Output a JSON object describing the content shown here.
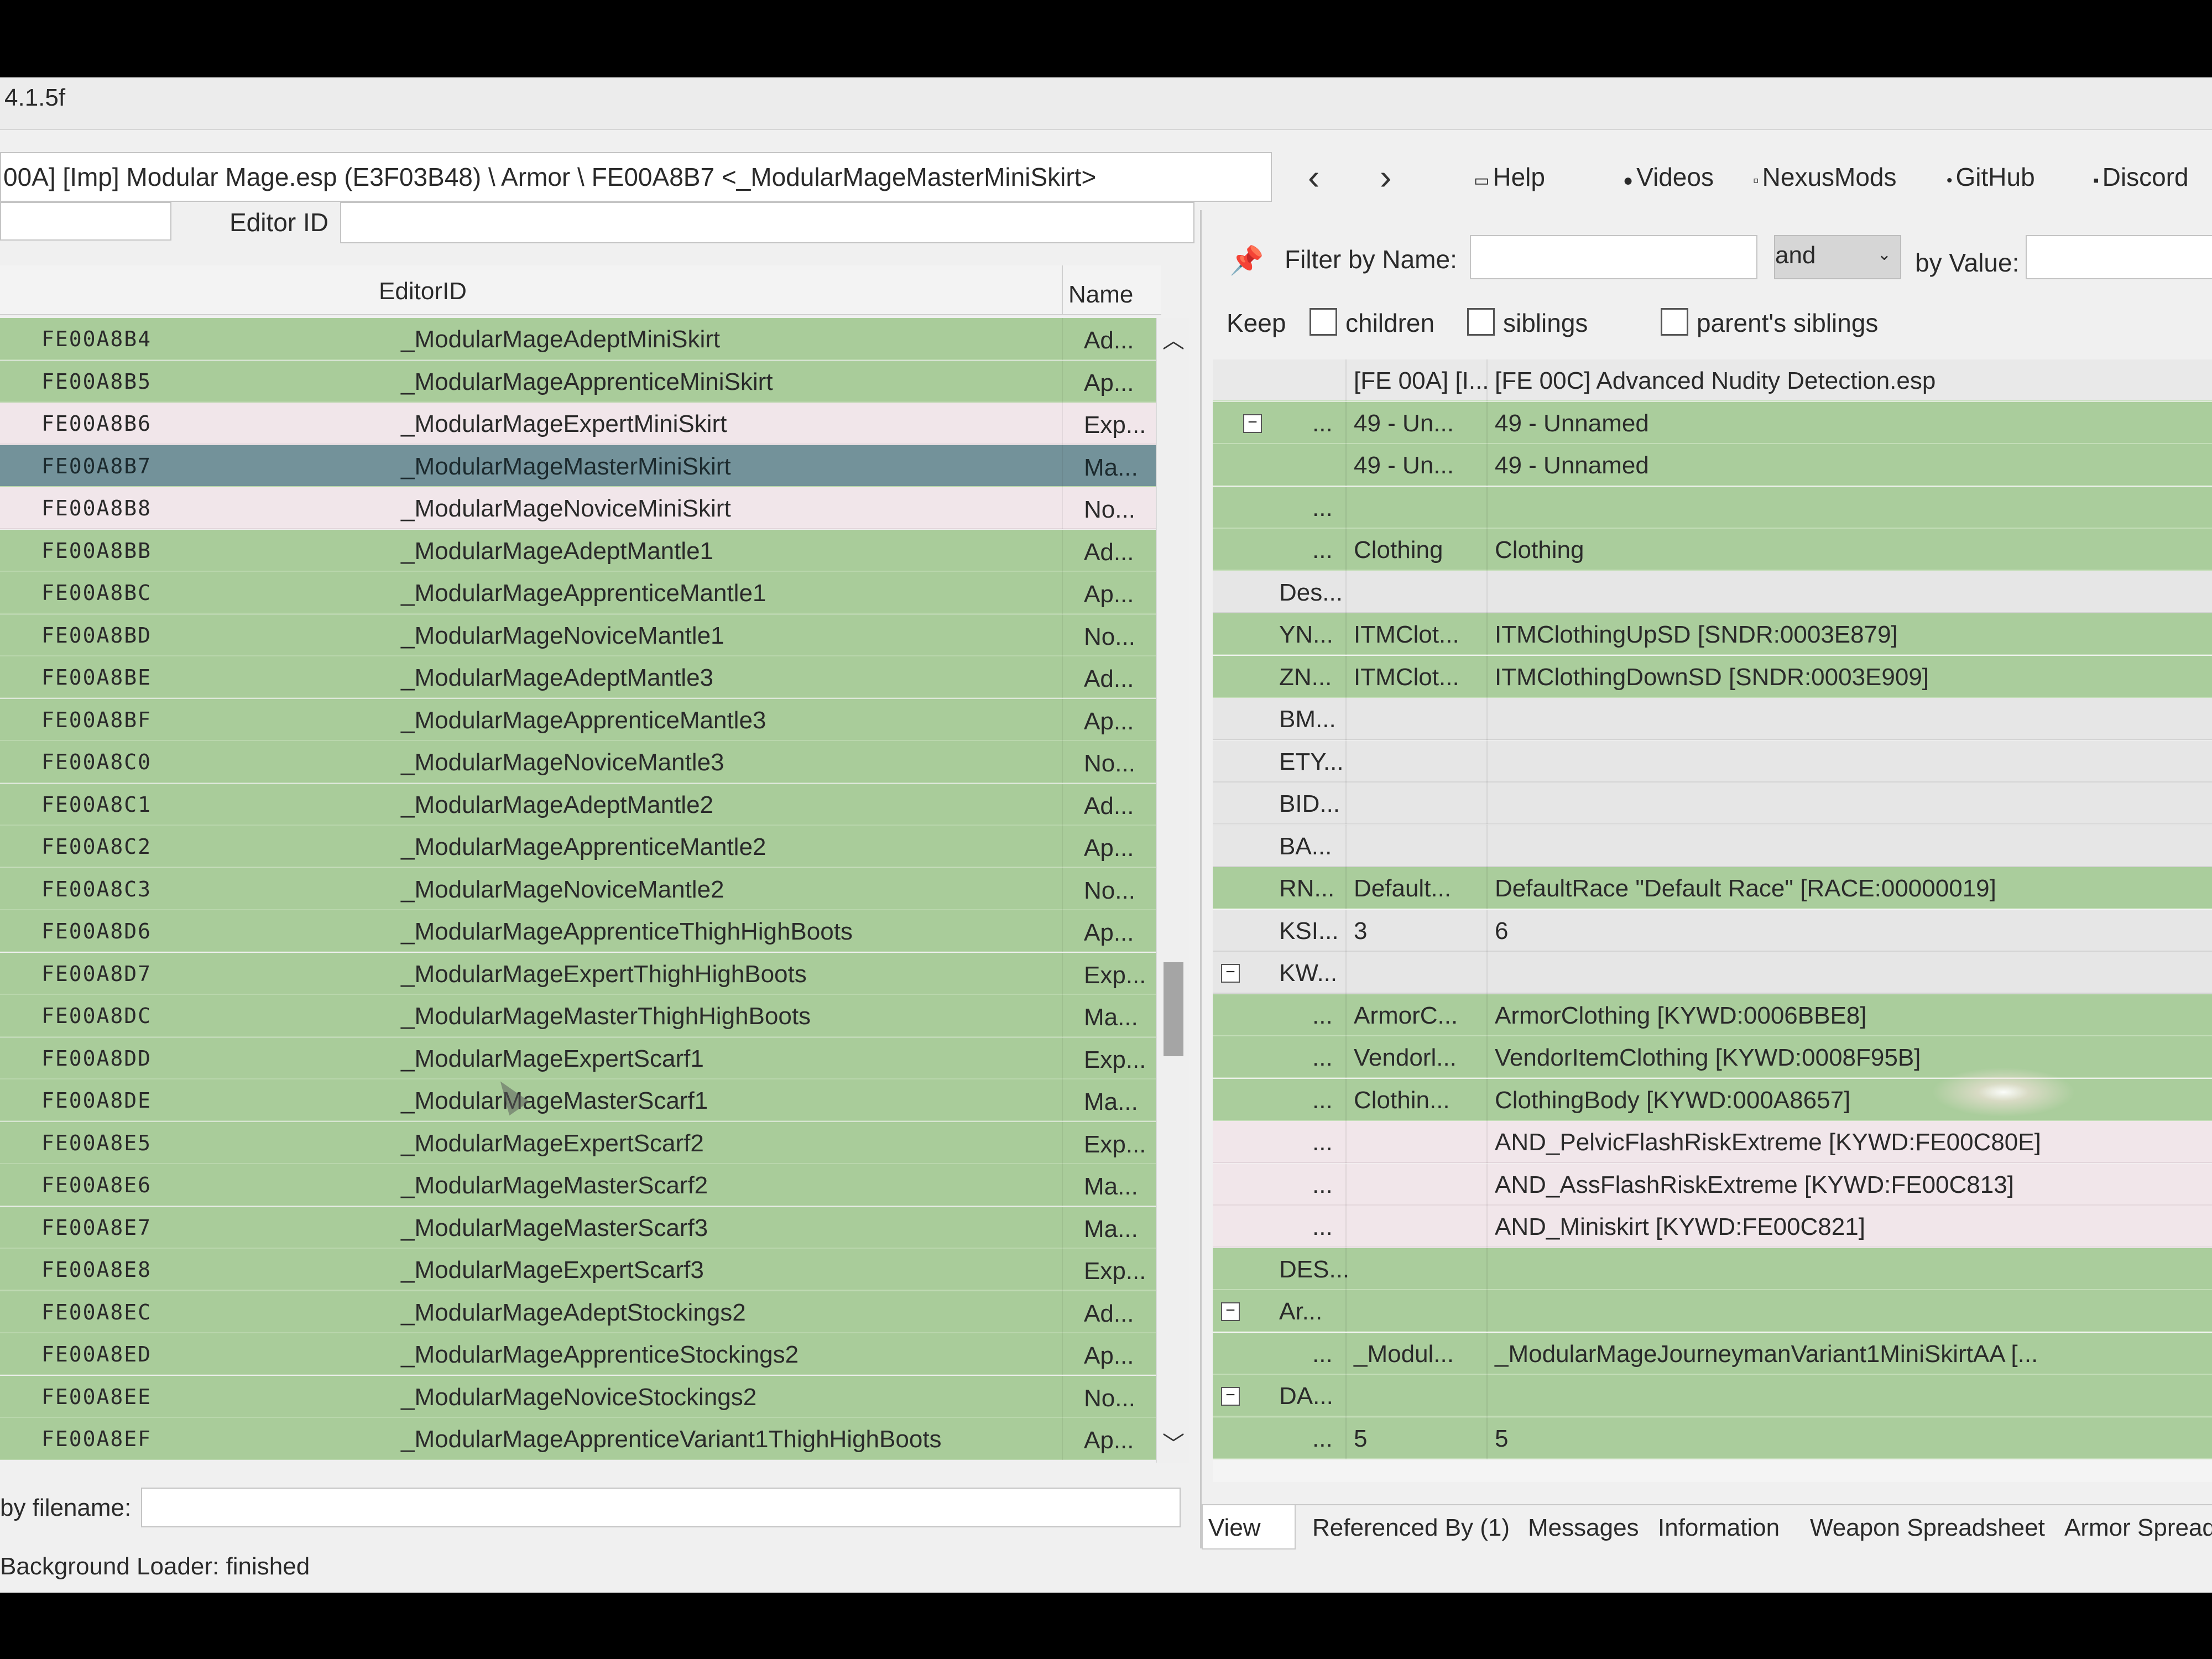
{
  "window": {
    "title": "4.1.5f"
  },
  "toolbar": {
    "path": "00A] [Imp] Modular Mage.esp (E3F03B48) \\ Armor \\ FE00A8B7 <_ModularMageMasterMiniSkirt>",
    "back_icon": "chevron-left-icon",
    "forward_icon": "chevron-right-icon",
    "links": {
      "help": "Help",
      "videos": "Videos",
      "nexusmods": "NexusMods",
      "github": "GitHub",
      "discord": "Discord"
    }
  },
  "left": {
    "editor_id_label": "Editor ID",
    "columns": {
      "editorid": "EditorID",
      "name": "Name"
    },
    "rows": [
      {
        "fid": "FE00A8B4",
        "edid": "_ModularMageAdeptMiniSkirt",
        "name": "Ad..."
      },
      {
        "fid": "FE00A8B5",
        "edid": "_ModularMageApprenticeMiniSkirt",
        "name": "Ap..."
      },
      {
        "fid": "FE00A8B6",
        "edid": "_ModularMageExpertMiniSkirt",
        "name": "Exp..."
      },
      {
        "fid": "FE00A8B7",
        "edid": "_ModularMageMasterMiniSkirt",
        "name": "Ma..."
      },
      {
        "fid": "FE00A8B8",
        "edid": "_ModularMageNoviceMiniSkirt",
        "name": "No..."
      },
      {
        "fid": "FE00A8BB",
        "edid": "_ModularMageAdeptMantle1",
        "name": "Ad..."
      },
      {
        "fid": "FE00A8BC",
        "edid": "_ModularMageApprenticeMantle1",
        "name": "Ap..."
      },
      {
        "fid": "FE00A8BD",
        "edid": "_ModularMageNoviceMantle1",
        "name": "No..."
      },
      {
        "fid": "FE00A8BE",
        "edid": "_ModularMageAdeptMantle3",
        "name": "Ad..."
      },
      {
        "fid": "FE00A8BF",
        "edid": "_ModularMageApprenticeMantle3",
        "name": "Ap..."
      },
      {
        "fid": "FE00A8C0",
        "edid": "_ModularMageNoviceMantle3",
        "name": "No..."
      },
      {
        "fid": "FE00A8C1",
        "edid": "_ModularMageAdeptMantle2",
        "name": "Ad..."
      },
      {
        "fid": "FE00A8C2",
        "edid": "_ModularMageApprenticeMantle2",
        "name": "Ap..."
      },
      {
        "fid": "FE00A8C3",
        "edid": "_ModularMageNoviceMantle2",
        "name": "No..."
      },
      {
        "fid": "FE00A8D6",
        "edid": "_ModularMageApprenticeThighHighBoots",
        "name": "Ap..."
      },
      {
        "fid": "FE00A8D7",
        "edid": "_ModularMageExpertThighHighBoots",
        "name": "Exp..."
      },
      {
        "fid": "FE00A8DC",
        "edid": "_ModularMageMasterThighHighBoots",
        "name": "Ma..."
      },
      {
        "fid": "FE00A8DD",
        "edid": "_ModularMageExpertScarf1",
        "name": "Exp..."
      },
      {
        "fid": "FE00A8DE",
        "edid": "_ModularMageMasterScarf1",
        "name": "Ma..."
      },
      {
        "fid": "FE00A8E5",
        "edid": "_ModularMageExpertScarf2",
        "name": "Exp..."
      },
      {
        "fid": "FE00A8E6",
        "edid": "_ModularMageMasterScarf2",
        "name": "Ma..."
      },
      {
        "fid": "FE00A8E7",
        "edid": "_ModularMageMasterScarf3",
        "name": "Ma..."
      },
      {
        "fid": "FE00A8E8",
        "edid": "_ModularMageExpertScarf3",
        "name": "Exp..."
      },
      {
        "fid": "FE00A8EC",
        "edid": "_ModularMageAdeptStockings2",
        "name": "Ad..."
      },
      {
        "fid": "FE00A8ED",
        "edid": "_ModularMageApprenticeStockings2",
        "name": "Ap..."
      },
      {
        "fid": "FE00A8EE",
        "edid": "_ModularMageNoviceStockings2",
        "name": "No..."
      },
      {
        "fid": "FE00A8EF",
        "edid": "_ModularMageApprenticeVariant1ThighHighBoots",
        "name": "Ap..."
      }
    ],
    "filename_label": "by filename:"
  },
  "right": {
    "filter_name_label": "Filter by Name:",
    "filter_op": "and",
    "filter_value_label": "by Value:",
    "keep_label": "Keep",
    "keep_children": "children",
    "keep_siblings": "siblings",
    "keep_parents_siblings": "parent's siblings",
    "tree": [
      {
        "label": "",
        "c2": "[FE 00A] [I...",
        "c3": "[FE 00C] Advanced Nudity Detection.esp"
      },
      {
        "label": "...",
        "c2": "49 - Un...",
        "c3": "49 - Unnamed"
      },
      {
        "label": "",
        "c2": "49 - Un...",
        "c3": "49 - Unnamed"
      },
      {
        "label": "...",
        "c2": "",
        "c3": ""
      },
      {
        "label": "...",
        "c2": "Clothing",
        "c3": "Clothing"
      },
      {
        "label": "Des...",
        "c2": "",
        "c3": ""
      },
      {
        "label": "YN...",
        "c2": "ITMClot...",
        "c3": "ITMClothingUpSD [SNDR:0003E879]"
      },
      {
        "label": "ZN...",
        "c2": "ITMClot...",
        "c3": "ITMClothingDownSD [SNDR:0003E909]"
      },
      {
        "label": "BM...",
        "c2": "",
        "c3": ""
      },
      {
        "label": "ETY...",
        "c2": "",
        "c3": ""
      },
      {
        "label": "BID...",
        "c2": "",
        "c3": ""
      },
      {
        "label": "BA...",
        "c2": "",
        "c3": ""
      },
      {
        "label": "RN...",
        "c2": "Default...",
        "c3": "DefaultRace \"Default Race\" [RACE:00000019]"
      },
      {
        "label": "KSI...",
        "c2": "3",
        "c3": "6"
      },
      {
        "label": "KW...",
        "c2": "",
        "c3": ""
      },
      {
        "label": "...",
        "c2": "ArmorC...",
        "c3": "ArmorClothing [KYWD:0006BBE8]"
      },
      {
        "label": "...",
        "c2": "Vendorl...",
        "c3": "VendorItemClothing [KYWD:0008F95B]"
      },
      {
        "label": "...",
        "c2": "Clothin...",
        "c3": "ClothingBody [KYWD:000A8657]"
      },
      {
        "label": "...",
        "c2": "",
        "c3": "AND_PelvicFlashRiskExtreme [KYWD:FE00C80E]"
      },
      {
        "label": "...",
        "c2": "",
        "c3": "AND_AssFlashRiskExtreme [KYWD:FE00C813]"
      },
      {
        "label": "...",
        "c2": "",
        "c3": "AND_Miniskirt [KYWD:FE00C821]"
      },
      {
        "label": "DES...",
        "c2": "",
        "c3": ""
      },
      {
        "label": "Ar...",
        "c2": "",
        "c3": ""
      },
      {
        "label": "...",
        "c2": "_Modul...",
        "c3": "_ModularMageJourneymanVariant1MiniSkirtAA [..."
      },
      {
        "label": "DA...",
        "c2": "",
        "c3": ""
      },
      {
        "label": "...",
        "c2": "5",
        "c3": "5"
      }
    ],
    "tabs": {
      "view": "View",
      "referenced_by": "Referenced By (1)",
      "messages": "Messages",
      "information": "Information",
      "weapon_spreadsheet": "Weapon Spreadsheet",
      "armor_spreadsheet": "Armor Spread"
    }
  },
  "status": {
    "text": "Background Loader: finished"
  },
  "colors": {
    "row_green": "#a9cc9a",
    "row_pink": "#f1e6ea",
    "row_selected": "#73929a",
    "row_gray": "#e6e6e6"
  }
}
